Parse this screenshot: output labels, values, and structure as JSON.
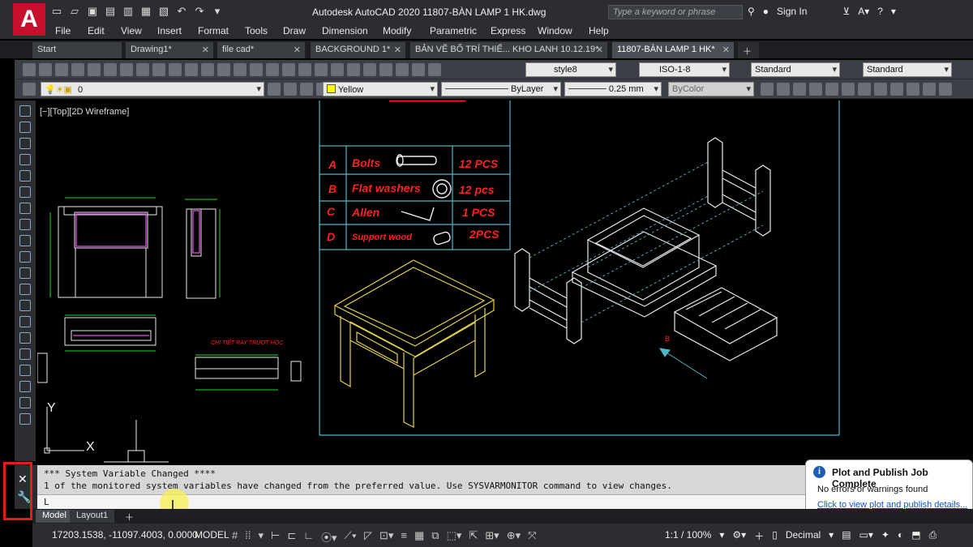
{
  "app": {
    "logo_letter": "A",
    "title": "Autodesk AutoCAD 2020     11807-BÀN LAMP 1 HK.dwg",
    "search_placeholder": "Type a keyword or phrase",
    "sign_in": "Sign In",
    "help": "?"
  },
  "menu": [
    "File",
    "Edit",
    "View",
    "Insert",
    "Format",
    "Tools",
    "Draw",
    "Dimension",
    "Modify",
    "Parametric",
    "Express",
    "Window",
    "Help"
  ],
  "tabs": [
    {
      "label": "Start"
    },
    {
      "label": "Drawing1*"
    },
    {
      "label": "file cad*"
    },
    {
      "label": "BACKGROUND 1*"
    },
    {
      "label": "BẢN VẼ BỐ TRÍ THIẾ... KHO LANH 10.12.19*"
    },
    {
      "label": "11807-BÀN LAMP 1 HK*"
    }
  ],
  "toolbar1": {
    "text_style": "style8",
    "dim_style": "ISO-1-8",
    "table_style": "Standard",
    "multileader_style": "Standard"
  },
  "toolbar2": {
    "layer": "0",
    "color": "Yellow",
    "linetype": "ByLayer",
    "lineweight": "0.25 mm",
    "plot_style": "ByColor"
  },
  "viewport_label": "[−][Top][2D Wireframe]",
  "drawing": {
    "parts_table": [
      {
        "letter": "A",
        "name": "Bolts",
        "qty": "12 PCS"
      },
      {
        "letter": "B",
        "name": "Flat washers",
        "qty": "12 pcs"
      },
      {
        "letter": "C",
        "name": "Allen",
        "qty": "1 PCS"
      },
      {
        "letter": "D",
        "name": "Support wood",
        "qty": "2PCS"
      }
    ],
    "detail_label": "CHI TIẾT RAY TRƯỢT HỘC",
    "ucs_x": "X",
    "ucs_y": "Y"
  },
  "command": {
    "line1": "*** System Variable Changed ****",
    "line2": "1 of the monitored system variables have changed from the preferred value. Use SYSVARMONITOR command to view changes.",
    "input": "L"
  },
  "layout_tabs": [
    "Model",
    "Layout1"
  ],
  "status": {
    "coords": "17203.1538, -11097.4003, 0.0000",
    "model": "MODEL",
    "scale": "1:1 / 100%",
    "units": "Decimal"
  },
  "balloon": {
    "title": "Plot and Publish Job Complete",
    "body": "No errors or warnings found",
    "link": "Click to view plot and publish details..."
  },
  "colors": {
    "red_highlight": "#e41b17",
    "drawing_green": "#1fd81f",
    "drawing_yellow": "#e6d24a",
    "drawing_cyan": "#4fb8c8"
  }
}
